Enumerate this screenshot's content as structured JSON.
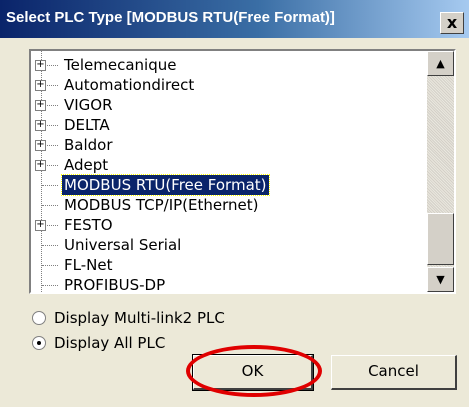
{
  "window": {
    "title": "Select PLC Type [MODBUS RTU(Free Format)]",
    "close_label": "x"
  },
  "tree": {
    "items": [
      {
        "label": "Telemecanique",
        "expandable": true,
        "selected": false
      },
      {
        "label": "Automationdirect",
        "expandable": true,
        "selected": false
      },
      {
        "label": "VIGOR",
        "expandable": true,
        "selected": false
      },
      {
        "label": "DELTA",
        "expandable": true,
        "selected": false
      },
      {
        "label": "Baldor",
        "expandable": true,
        "selected": false
      },
      {
        "label": "Adept",
        "expandable": true,
        "selected": false
      },
      {
        "label": "MODBUS RTU(Free Format)",
        "expandable": false,
        "selected": true
      },
      {
        "label": "MODBUS TCP/IP(Ethernet)",
        "expandable": false,
        "selected": false
      },
      {
        "label": "FESTO",
        "expandable": true,
        "selected": false
      },
      {
        "label": "Universal Serial",
        "expandable": false,
        "selected": false
      },
      {
        "label": "FL-Net",
        "expandable": false,
        "selected": false
      },
      {
        "label": "PROFIBUS-DP",
        "expandable": false,
        "selected": false
      }
    ],
    "expander_glyph": "+",
    "scroll_up_glyph": "▲",
    "scroll_down_glyph": "▼"
  },
  "options": {
    "multi_link2": {
      "label": "Display Multi-link2 PLC",
      "checked": false
    },
    "all_plc": {
      "label": "Display All PLC",
      "checked": true
    }
  },
  "buttons": {
    "ok_label": "OK",
    "cancel_label": "Cancel"
  },
  "colors": {
    "title_start": "#0a246a",
    "title_end": "#a6caf0",
    "selection_bg": "#0a246a",
    "annotation_red": "#e00000"
  }
}
